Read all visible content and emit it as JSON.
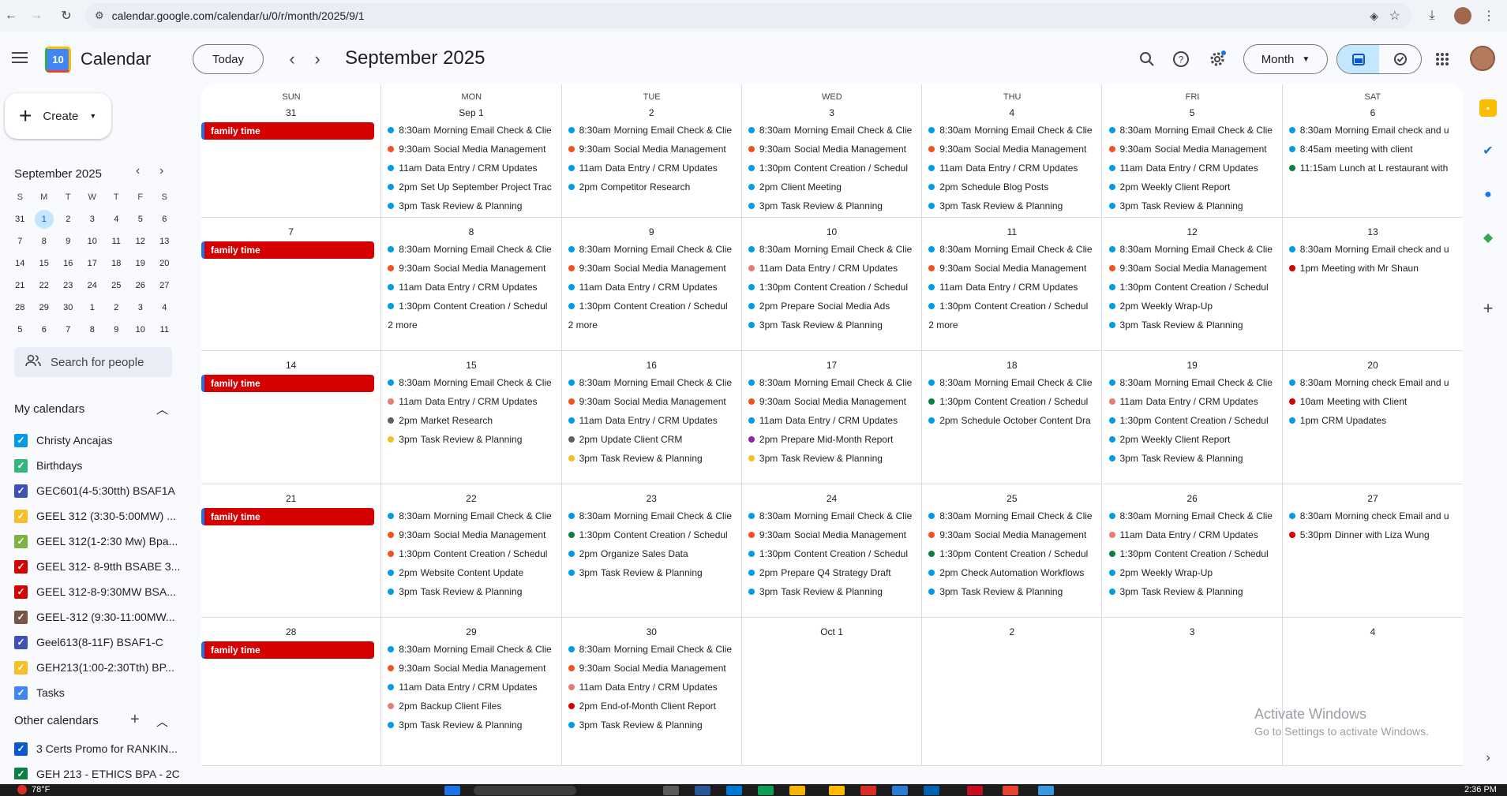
{
  "browser": {
    "url": "calendar.google.com/calendar/u/0/r/month/2025/9/1"
  },
  "header": {
    "app_title": "Calendar",
    "logo_day": "10",
    "today": "Today",
    "month_title": "September 2025",
    "view": "Month"
  },
  "sidebar": {
    "create": "Create",
    "mini_title": "September 2025",
    "mini_dow": [
      "S",
      "M",
      "T",
      "W",
      "T",
      "F",
      "S"
    ],
    "mini_days": [
      "31",
      "1",
      "2",
      "3",
      "4",
      "5",
      "6",
      "7",
      "8",
      "9",
      "10",
      "11",
      "12",
      "13",
      "14",
      "15",
      "16",
      "17",
      "18",
      "19",
      "20",
      "21",
      "22",
      "23",
      "24",
      "25",
      "26",
      "27",
      "28",
      "29",
      "30",
      "1",
      "2",
      "3",
      "4",
      "5",
      "6",
      "7",
      "8",
      "9",
      "10",
      "11"
    ],
    "mini_selected": "1",
    "search_people": "Search for people",
    "my_calendars_title": "My calendars",
    "my_calendars": [
      {
        "name": "Christy Ancajas",
        "color": "#039be5"
      },
      {
        "name": "Birthdays",
        "color": "#33b679"
      },
      {
        "name": "GEC601(4-5:30tth) BSAF1A",
        "color": "#3f51b5"
      },
      {
        "name": "GEEL 312 (3:30-5:00MW) ...",
        "color": "#f6bf26"
      },
      {
        "name": "GEEL 312(1-2:30 Mw) Bpa...",
        "color": "#7cb342"
      },
      {
        "name": "GEEL 312- 8-9tth BSABE 3...",
        "color": "#d50000"
      },
      {
        "name": "GEEL 312-8-9:30MW BSA...",
        "color": "#d50000"
      },
      {
        "name": "GEEL-312 (9:30-11:00MW...",
        "color": "#795548"
      },
      {
        "name": "Geel613(8-11F) BSAF1-C",
        "color": "#3f51b5"
      },
      {
        "name": "GEH213(1:00-2:30Tth) BP...",
        "color": "#f6bf26"
      },
      {
        "name": "Tasks",
        "color": "#4285f4"
      }
    ],
    "other_calendars_title": "Other calendars",
    "other_calendars": [
      {
        "name": "3 Certs Promo for RANKIN...",
        "color": "#0b57d0"
      },
      {
        "name": "GEH 213 - ETHICS BPA - 2C",
        "color": "#0b8043"
      }
    ]
  },
  "grid": {
    "dow": [
      "SUN",
      "MON",
      "TUE",
      "WED",
      "THU",
      "FRI",
      "SAT"
    ],
    "weeks": [
      [
        {
          "day": "31",
          "bar": "family time",
          "events": []
        },
        {
          "day": "Sep 1",
          "events": [
            [
              "8:30am",
              "Morning Email Check & Clie",
              "#039be5"
            ],
            [
              "9:30am",
              "Social Media Management",
              "#f4511e"
            ],
            [
              "11am",
              "Data Entry / CRM Updates",
              "#039be5"
            ],
            [
              "2pm",
              "Set Up September Project Trac",
              "#039be5"
            ],
            [
              "3pm",
              "Task Review & Planning",
              "#039be5"
            ]
          ]
        },
        {
          "day": "2",
          "events": [
            [
              "8:30am",
              "Morning Email Check & Clie",
              "#039be5"
            ],
            [
              "9:30am",
              "Social Media Management",
              "#f4511e"
            ],
            [
              "11am",
              "Data Entry / CRM Updates",
              "#039be5"
            ],
            [
              "2pm",
              "Competitor Research",
              "#039be5"
            ]
          ]
        },
        {
          "day": "3",
          "events": [
            [
              "8:30am",
              "Morning Email Check & Clie",
              "#039be5"
            ],
            [
              "9:30am",
              "Social Media Management",
              "#f4511e"
            ],
            [
              "1:30pm",
              "Content Creation / Schedul",
              "#039be5"
            ],
            [
              "2pm",
              "Client Meeting",
              "#039be5"
            ],
            [
              "3pm",
              "Task Review & Planning",
              "#039be5"
            ]
          ]
        },
        {
          "day": "4",
          "events": [
            [
              "8:30am",
              "Morning Email Check & Clie",
              "#039be5"
            ],
            [
              "9:30am",
              "Social Media Management",
              "#f4511e"
            ],
            [
              "11am",
              "Data Entry / CRM Updates",
              "#039be5"
            ],
            [
              "2pm",
              "Schedule Blog Posts",
              "#039be5"
            ],
            [
              "3pm",
              "Task Review & Planning",
              "#039be5"
            ]
          ]
        },
        {
          "day": "5",
          "events": [
            [
              "8:30am",
              "Morning Email Check & Clie",
              "#039be5"
            ],
            [
              "9:30am",
              "Social Media Management",
              "#f4511e"
            ],
            [
              "11am",
              "Data Entry / CRM Updates",
              "#039be5"
            ],
            [
              "2pm",
              "Weekly Client Report",
              "#039be5"
            ],
            [
              "3pm",
              "Task Review & Planning",
              "#039be5"
            ]
          ]
        },
        {
          "day": "6",
          "events": [
            [
              "8:30am",
              "Morning Email check and u",
              "#039be5"
            ],
            [
              "8:45am",
              "meeting with client",
              "#039be5"
            ],
            [
              "11:15am",
              "Lunch at L restaurant with",
              "#0b8043"
            ]
          ]
        }
      ],
      [
        {
          "day": "7",
          "bar": "family time",
          "events": []
        },
        {
          "day": "8",
          "events": [
            [
              "8:30am",
              "Morning Email Check & Clie",
              "#039be5"
            ],
            [
              "9:30am",
              "Social Media Management",
              "#f4511e"
            ],
            [
              "11am",
              "Data Entry / CRM Updates",
              "#039be5"
            ],
            [
              "1:30pm",
              "Content Creation / Schedul",
              "#039be5"
            ]
          ],
          "more": "2 more"
        },
        {
          "day": "9",
          "events": [
            [
              "8:30am",
              "Morning Email Check & Clie",
              "#039be5"
            ],
            [
              "9:30am",
              "Social Media Management",
              "#f4511e"
            ],
            [
              "11am",
              "Data Entry / CRM Updates",
              "#039be5"
            ],
            [
              "1:30pm",
              "Content Creation / Schedul",
              "#039be5"
            ]
          ],
          "more": "2 more"
        },
        {
          "day": "10",
          "events": [
            [
              "8:30am",
              "Morning Email Check & Clie",
              "#039be5"
            ],
            [
              "11am",
              "Data Entry / CRM Updates",
              "#e67c73"
            ],
            [
              "1:30pm",
              "Content Creation / Schedul",
              "#039be5"
            ],
            [
              "2pm",
              "Prepare Social Media Ads",
              "#039be5"
            ],
            [
              "3pm",
              "Task Review & Planning",
              "#039be5"
            ]
          ]
        },
        {
          "day": "11",
          "events": [
            [
              "8:30am",
              "Morning Email Check & Clie",
              "#039be5"
            ],
            [
              "9:30am",
              "Social Media Management",
              "#f4511e"
            ],
            [
              "11am",
              "Data Entry / CRM Updates",
              "#039be5"
            ],
            [
              "1:30pm",
              "Content Creation / Schedul",
              "#039be5"
            ]
          ],
          "more": "2 more"
        },
        {
          "day": "12",
          "events": [
            [
              "8:30am",
              "Morning Email Check & Clie",
              "#039be5"
            ],
            [
              "9:30am",
              "Social Media Management",
              "#f4511e"
            ],
            [
              "1:30pm",
              "Content Creation / Schedul",
              "#039be5"
            ],
            [
              "2pm",
              "Weekly Wrap-Up",
              "#039be5"
            ],
            [
              "3pm",
              "Task Review & Planning",
              "#039be5"
            ]
          ]
        },
        {
          "day": "13",
          "events": [
            [
              "8:30am",
              "Morning Email check and u",
              "#039be5"
            ],
            [
              "1pm",
              "Meeting with Mr Shaun",
              "#d50000"
            ]
          ]
        }
      ],
      [
        {
          "day": "14",
          "bar": "family time",
          "events": []
        },
        {
          "day": "15",
          "events": [
            [
              "8:30am",
              "Morning Email Check & Clie",
              "#039be5"
            ],
            [
              "11am",
              "Data Entry / CRM Updates",
              "#e67c73"
            ],
            [
              "2pm",
              "Market Research",
              "#616161"
            ],
            [
              "3pm",
              "Task Review & Planning",
              "#f6bf26"
            ]
          ]
        },
        {
          "day": "16",
          "events": [
            [
              "8:30am",
              "Morning Email Check & Clie",
              "#039be5"
            ],
            [
              "9:30am",
              "Social Media Management",
              "#f4511e"
            ],
            [
              "11am",
              "Data Entry / CRM Updates",
              "#039be5"
            ],
            [
              "2pm",
              "Update Client CRM",
              "#616161"
            ],
            [
              "3pm",
              "Task Review & Planning",
              "#f6bf26"
            ]
          ]
        },
        {
          "day": "17",
          "events": [
            [
              "8:30am",
              "Morning Email Check & Clie",
              "#039be5"
            ],
            [
              "9:30am",
              "Social Media Management",
              "#f4511e"
            ],
            [
              "11am",
              "Data Entry / CRM Updates",
              "#039be5"
            ],
            [
              "2pm",
              "Prepare Mid-Month Report",
              "#8e24aa"
            ],
            [
              "3pm",
              "Task Review & Planning",
              "#f6bf26"
            ]
          ]
        },
        {
          "day": "18",
          "events": [
            [
              "8:30am",
              "Morning Email Check & Clie",
              "#039be5"
            ],
            [
              "1:30pm",
              "Content Creation / Schedul",
              "#0b8043"
            ],
            [
              "2pm",
              "Schedule October Content Dra",
              "#039be5"
            ]
          ]
        },
        {
          "day": "19",
          "events": [
            [
              "8:30am",
              "Morning Email Check & Clie",
              "#039be5"
            ],
            [
              "11am",
              "Data Entry / CRM Updates",
              "#e67c73"
            ],
            [
              "1:30pm",
              "Content Creation / Schedul",
              "#039be5"
            ],
            [
              "2pm",
              "Weekly Client Report",
              "#039be5"
            ],
            [
              "3pm",
              "Task Review & Planning",
              "#039be5"
            ]
          ]
        },
        {
          "day": "20",
          "events": [
            [
              "8:30am",
              "Morning check Email and u",
              "#039be5"
            ],
            [
              "10am",
              "Meeting with Client",
              "#d50000"
            ],
            [
              "1pm",
              "CRM Upadates",
              "#039be5"
            ]
          ]
        }
      ],
      [
        {
          "day": "21",
          "bar": "family time",
          "events": []
        },
        {
          "day": "22",
          "events": [
            [
              "8:30am",
              "Morning Email Check & Clie",
              "#039be5"
            ],
            [
              "9:30am",
              "Social Media Management",
              "#f4511e"
            ],
            [
              "1:30pm",
              "Content Creation / Schedul",
              "#f4511e"
            ],
            [
              "2pm",
              "Website Content Update",
              "#039be5"
            ],
            [
              "3pm",
              "Task Review & Planning",
              "#039be5"
            ]
          ]
        },
        {
          "day": "23",
          "events": [
            [
              "8:30am",
              "Morning Email Check & Clie",
              "#039be5"
            ],
            [
              "1:30pm",
              "Content Creation / Schedul",
              "#0b8043"
            ],
            [
              "2pm",
              "Organize Sales Data",
              "#039be5"
            ],
            [
              "3pm",
              "Task Review & Planning",
              "#039be5"
            ]
          ]
        },
        {
          "day": "24",
          "events": [
            [
              "8:30am",
              "Morning Email Check & Clie",
              "#039be5"
            ],
            [
              "9:30am",
              "Social Media Management",
              "#f4511e"
            ],
            [
              "1:30pm",
              "Content Creation / Schedul",
              "#039be5"
            ],
            [
              "2pm",
              "Prepare Q4 Strategy Draft",
              "#039be5"
            ],
            [
              "3pm",
              "Task Review & Planning",
              "#039be5"
            ]
          ]
        },
        {
          "day": "25",
          "events": [
            [
              "8:30am",
              "Morning Email Check & Clie",
              "#039be5"
            ],
            [
              "9:30am",
              "Social Media Management",
              "#f4511e"
            ],
            [
              "1:30pm",
              "Content Creation / Schedul",
              "#0b8043"
            ],
            [
              "2pm",
              "Check Automation Workflows",
              "#039be5"
            ],
            [
              "3pm",
              "Task Review & Planning",
              "#039be5"
            ]
          ]
        },
        {
          "day": "26",
          "events": [
            [
              "8:30am",
              "Morning Email Check & Clie",
              "#039be5"
            ],
            [
              "11am",
              "Data Entry / CRM Updates",
              "#e67c73"
            ],
            [
              "1:30pm",
              "Content Creation / Schedul",
              "#0b8043"
            ],
            [
              "2pm",
              "Weekly Wrap-Up",
              "#039be5"
            ],
            [
              "3pm",
              "Task Review & Planning",
              "#039be5"
            ]
          ]
        },
        {
          "day": "27",
          "events": [
            [
              "8:30am",
              "Morning check Email and u",
              "#039be5"
            ],
            [
              "5:30pm",
              "Dinner with Liza Wung",
              "#d50000"
            ]
          ]
        }
      ],
      [
        {
          "day": "28",
          "bar": "family time",
          "events": []
        },
        {
          "day": "29",
          "events": [
            [
              "8:30am",
              "Morning Email Check & Clie",
              "#039be5"
            ],
            [
              "9:30am",
              "Social Media Management",
              "#f4511e"
            ],
            [
              "11am",
              "Data Entry / CRM Updates",
              "#039be5"
            ],
            [
              "2pm",
              "Backup Client Files",
              "#e67c73"
            ],
            [
              "3pm",
              "Task Review & Planning",
              "#039be5"
            ]
          ]
        },
        {
          "day": "30",
          "events": [
            [
              "8:30am",
              "Morning Email Check & Clie",
              "#039be5"
            ],
            [
              "9:30am",
              "Social Media Management",
              "#f4511e"
            ],
            [
              "11am",
              "Data Entry / CRM Updates",
              "#e67c73"
            ],
            [
              "2pm",
              "End-of-Month Client Report",
              "#d50000"
            ],
            [
              "3pm",
              "Task Review & Planning",
              "#039be5"
            ]
          ]
        },
        {
          "day": "Oct 1",
          "events": []
        },
        {
          "day": "2",
          "events": []
        },
        {
          "day": "3",
          "events": []
        },
        {
          "day": "4",
          "events": []
        }
      ]
    ]
  },
  "watermark": {
    "line1": "Activate Windows",
    "line2": "Go to Settings to activate Windows."
  },
  "taskbar": {
    "weather": "78°F",
    "time": "2:36 PM"
  }
}
